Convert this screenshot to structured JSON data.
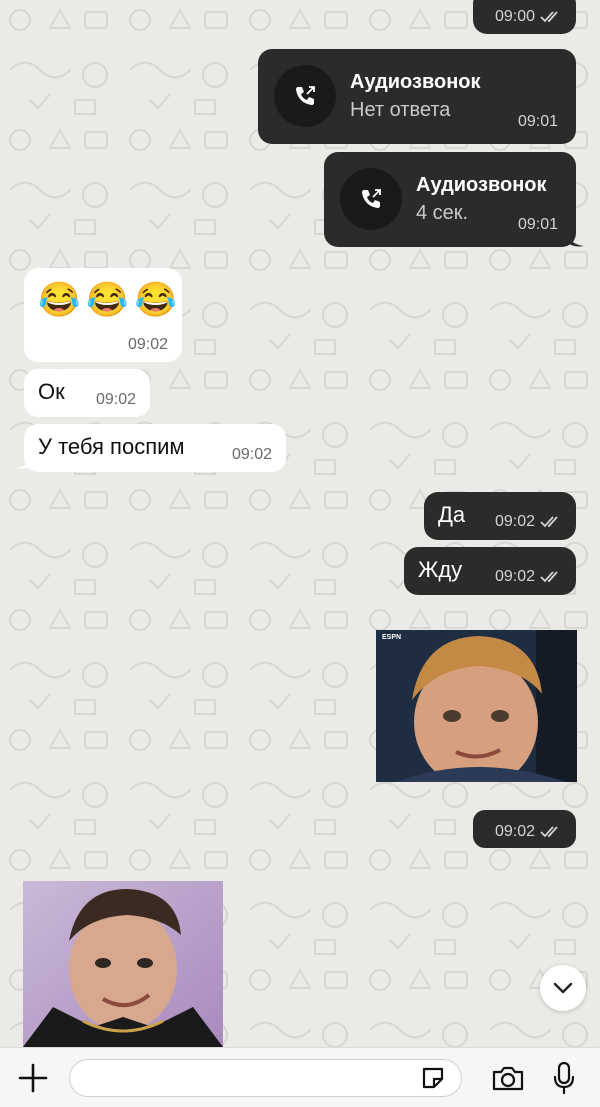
{
  "messages": {
    "m1_time": "09:00",
    "call1": {
      "title": "Аудиозвонок",
      "subtitle": "Нет ответа",
      "time": "09:01"
    },
    "call2": {
      "title": "Аудиозвонок",
      "subtitle": "4 сек.",
      "time": "09:01"
    },
    "emoji_msg": {
      "emojis": [
        "😂",
        "😂",
        "😂"
      ],
      "time": "09:02"
    },
    "ok_msg": {
      "text": "Ок",
      "time": "09:02"
    },
    "sleep_msg": {
      "text": "У тебя поспим",
      "time": "09:02"
    },
    "yes_msg": {
      "text": "Да",
      "time": "09:02"
    },
    "wait_msg": {
      "text": "Жду",
      "time": "09:02"
    },
    "sticker_out": {
      "caption": "ESPN",
      "time": "09:02"
    }
  },
  "input": {
    "placeholder": ""
  },
  "icons": {
    "attach": "plus-icon",
    "sticker": "sticker-icon",
    "camera": "camera-icon",
    "mic": "microphone-icon",
    "scroll": "chevron-down-icon",
    "call": "outgoing-call-icon",
    "read": "double-check-icon"
  },
  "colors": {
    "background": "#ebeae7",
    "outgoing_bubble": "#2b2b2b",
    "incoming_bubble": "#ffffff"
  }
}
